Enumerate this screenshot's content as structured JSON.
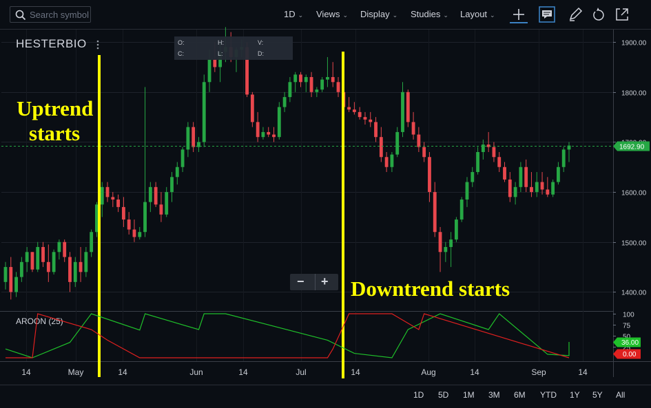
{
  "toolbar": {
    "search_placeholder": "Search symbol",
    "interval": "1D",
    "views": "Views",
    "display": "Display",
    "studies": "Studies",
    "layout": "Layout"
  },
  "symbol": "HESTERBIO",
  "ohlc_labels": {
    "o": "O:",
    "h": "H:",
    "v": "V:",
    "c": "C:",
    "l": "L:",
    "d": "D:"
  },
  "zoom": {
    "minus": "−",
    "plus": "+"
  },
  "annotations": {
    "uptrend_line1": "Uptrend",
    "uptrend_line2": "starts",
    "downtrend": "Downtrend starts"
  },
  "indicator_label": "AROON (25)",
  "ranges": [
    "1D",
    "5D",
    "1M",
    "3M",
    "6M",
    "YTD",
    "1Y",
    "5Y",
    "All"
  ],
  "colors": {
    "up": "#26a744",
    "down": "#e8474d",
    "annotation": "#ffff00",
    "aroon_up": "#1fbf2a",
    "aroon_down": "#e0201f"
  },
  "chart_data": {
    "type": "candlestick",
    "price_axis": {
      "ticks": [
        1900,
        1800,
        1700,
        1600,
        1500,
        1400
      ],
      "tick_labels": [
        "1900.00",
        "1800.00",
        "1700.00",
        "1600.00",
        "1500.00",
        "1400.00"
      ],
      "range": [
        1362,
        1925
      ]
    },
    "last_price": {
      "value": 1692.9,
      "label": "1692.90"
    },
    "x_axis": {
      "ticks": [
        "14",
        "May",
        "14",
        "Jun",
        "14",
        "Jul",
        "14",
        "Aug",
        "14",
        "Sep",
        "14"
      ]
    },
    "candles": [
      [
        1420,
        1460,
        1405,
        1450
      ],
      [
        1450,
        1470,
        1385,
        1400
      ],
      [
        1400,
        1440,
        1390,
        1430
      ],
      [
        1430,
        1470,
        1420,
        1460
      ],
      [
        1460,
        1490,
        1440,
        1480
      ],
      [
        1480,
        1480,
        1440,
        1445
      ],
      [
        1445,
        1500,
        1440,
        1490
      ],
      [
        1490,
        1500,
        1450,
        1460
      ],
      [
        1460,
        1495,
        1420,
        1440
      ],
      [
        1440,
        1485,
        1435,
        1480
      ],
      [
        1480,
        1505,
        1465,
        1500
      ],
      [
        1500,
        1505,
        1460,
        1470
      ],
      [
        1470,
        1480,
        1400,
        1420
      ],
      [
        1420,
        1470,
        1410,
        1460
      ],
      [
        1460,
        1490,
        1420,
        1440
      ],
      [
        1440,
        1490,
        1430,
        1480
      ],
      [
        1480,
        1525,
        1470,
        1520
      ],
      [
        1520,
        1580,
        1510,
        1575
      ],
      [
        1575,
        1620,
        1550,
        1610
      ],
      [
        1610,
        1620,
        1580,
        1590
      ],
      [
        1590,
        1600,
        1570,
        1585
      ],
      [
        1585,
        1595,
        1560,
        1570
      ],
      [
        1570,
        1590,
        1530,
        1545
      ],
      [
        1545,
        1560,
        1515,
        1525
      ],
      [
        1525,
        1545,
        1500,
        1510
      ],
      [
        1510,
        1530,
        1505,
        1520
      ],
      [
        1520,
        1810,
        1510,
        1580
      ],
      [
        1580,
        1620,
        1560,
        1610
      ],
      [
        1610,
        1620,
        1570,
        1575
      ],
      [
        1575,
        1600,
        1540,
        1555
      ],
      [
        1555,
        1610,
        1550,
        1600
      ],
      [
        1600,
        1640,
        1580,
        1630
      ],
      [
        1630,
        1660,
        1615,
        1650
      ],
      [
        1650,
        1690,
        1640,
        1685
      ],
      [
        1685,
        1740,
        1670,
        1730
      ],
      [
        1730,
        1740,
        1680,
        1690
      ],
      [
        1690,
        1710,
        1680,
        1700
      ],
      [
        1700,
        1835,
        1690,
        1820
      ],
      [
        1820,
        1885,
        1800,
        1865
      ],
      [
        1865,
        1900,
        1840,
        1850
      ],
      [
        1850,
        1900,
        1820,
        1880
      ],
      [
        1880,
        1930,
        1860,
        1890
      ],
      [
        1890,
        1920,
        1860,
        1870
      ],
      [
        1870,
        1890,
        1840,
        1885
      ],
      [
        1885,
        1905,
        1870,
        1890
      ],
      [
        1890,
        1900,
        1790,
        1795
      ],
      [
        1795,
        1800,
        1730,
        1740
      ],
      [
        1740,
        1760,
        1700,
        1710
      ],
      [
        1710,
        1730,
        1705,
        1720
      ],
      [
        1720,
        1730,
        1710,
        1715
      ],
      [
        1715,
        1730,
        1700,
        1710
      ],
      [
        1710,
        1780,
        1705,
        1770
      ],
      [
        1770,
        1800,
        1760,
        1790
      ],
      [
        1790,
        1830,
        1780,
        1820
      ],
      [
        1820,
        1840,
        1800,
        1835
      ],
      [
        1835,
        1840,
        1810,
        1820
      ],
      [
        1820,
        1835,
        1800,
        1830
      ],
      [
        1830,
        1840,
        1790,
        1800
      ],
      [
        1800,
        1810,
        1790,
        1805
      ],
      [
        1805,
        1830,
        1800,
        1825
      ],
      [
        1825,
        1870,
        1810,
        1830
      ],
      [
        1830,
        1860,
        1810,
        1820
      ],
      [
        1820,
        1830,
        1790,
        1800
      ],
      [
        1800,
        1810,
        1760,
        1770
      ],
      [
        1770,
        1790,
        1760,
        1765
      ],
      [
        1765,
        1780,
        1755,
        1760
      ],
      [
        1760,
        1770,
        1745,
        1750
      ],
      [
        1750,
        1760,
        1735,
        1745
      ],
      [
        1745,
        1760,
        1730,
        1740
      ],
      [
        1740,
        1750,
        1700,
        1710
      ],
      [
        1710,
        1730,
        1660,
        1670
      ],
      [
        1670,
        1680,
        1640,
        1650
      ],
      [
        1650,
        1680,
        1640,
        1675
      ],
      [
        1675,
        1730,
        1670,
        1720
      ],
      [
        1720,
        1820,
        1710,
        1800
      ],
      [
        1800,
        1805,
        1730,
        1740
      ],
      [
        1740,
        1760,
        1705,
        1715
      ],
      [
        1715,
        1730,
        1680,
        1690
      ],
      [
        1690,
        1700,
        1660,
        1670
      ],
      [
        1670,
        1680,
        1580,
        1600
      ],
      [
        1600,
        1620,
        1510,
        1520
      ],
      [
        1520,
        1530,
        1440,
        1480
      ],
      [
        1480,
        1500,
        1460,
        1490
      ],
      [
        1490,
        1520,
        1450,
        1505
      ],
      [
        1505,
        1550,
        1500,
        1545
      ],
      [
        1545,
        1590,
        1540,
        1585
      ],
      [
        1585,
        1630,
        1570,
        1620
      ],
      [
        1620,
        1650,
        1610,
        1640
      ],
      [
        1640,
        1690,
        1635,
        1680
      ],
      [
        1680,
        1705,
        1665,
        1695
      ],
      [
        1695,
        1720,
        1680,
        1690
      ],
      [
        1690,
        1700,
        1660,
        1670
      ],
      [
        1670,
        1680,
        1640,
        1650
      ],
      [
        1650,
        1660,
        1620,
        1625
      ],
      [
        1625,
        1640,
        1580,
        1590
      ],
      [
        1590,
        1620,
        1575,
        1610
      ],
      [
        1610,
        1660,
        1600,
        1650
      ],
      [
        1650,
        1665,
        1600,
        1610
      ],
      [
        1610,
        1640,
        1590,
        1600
      ],
      [
        1600,
        1640,
        1590,
        1620
      ],
      [
        1620,
        1640,
        1595,
        1605
      ],
      [
        1605,
        1630,
        1590,
        1595
      ],
      [
        1595,
        1625,
        1590,
        1620
      ],
      [
        1620,
        1660,
        1615,
        1650
      ],
      [
        1650,
        1690,
        1640,
        1685
      ],
      [
        1685,
        1700,
        1660,
        1693
      ]
    ],
    "aroon": {
      "name": "AROON (25)",
      "axis_ticks": [
        100,
        75,
        50,
        25
      ],
      "up_last": {
        "value": 36,
        "label": "36.00"
      },
      "down_last": {
        "value": 0,
        "label": "0.00"
      }
    }
  }
}
